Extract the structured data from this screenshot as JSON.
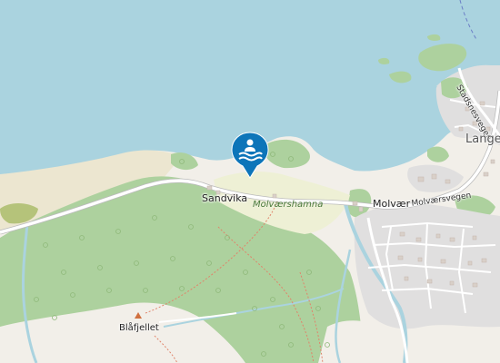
{
  "map": {
    "labels": {
      "sandvika": "Sandvika",
      "molvaershamna": "Molværshamna",
      "molvaer": "Molvær",
      "molvaersvegen": "Molværsvegen",
      "stadsnesvegen": "Stadsnesvegen",
      "lange": "Lange",
      "blafjellet": "Blåfjellet"
    },
    "icons": {
      "beach_marker": "swimming-beach-marker",
      "peak": "mountain-peak"
    },
    "colors": {
      "water": "#aad3df",
      "land": "#f2efe9",
      "forest": "#add19e",
      "forest_dark": "#8fb97a",
      "residential": "#e0dfdf",
      "sand": "#f5e9c6",
      "road": "#ffffff",
      "road_casing": "#bbbbbb",
      "marker": "#0d75b9"
    }
  }
}
